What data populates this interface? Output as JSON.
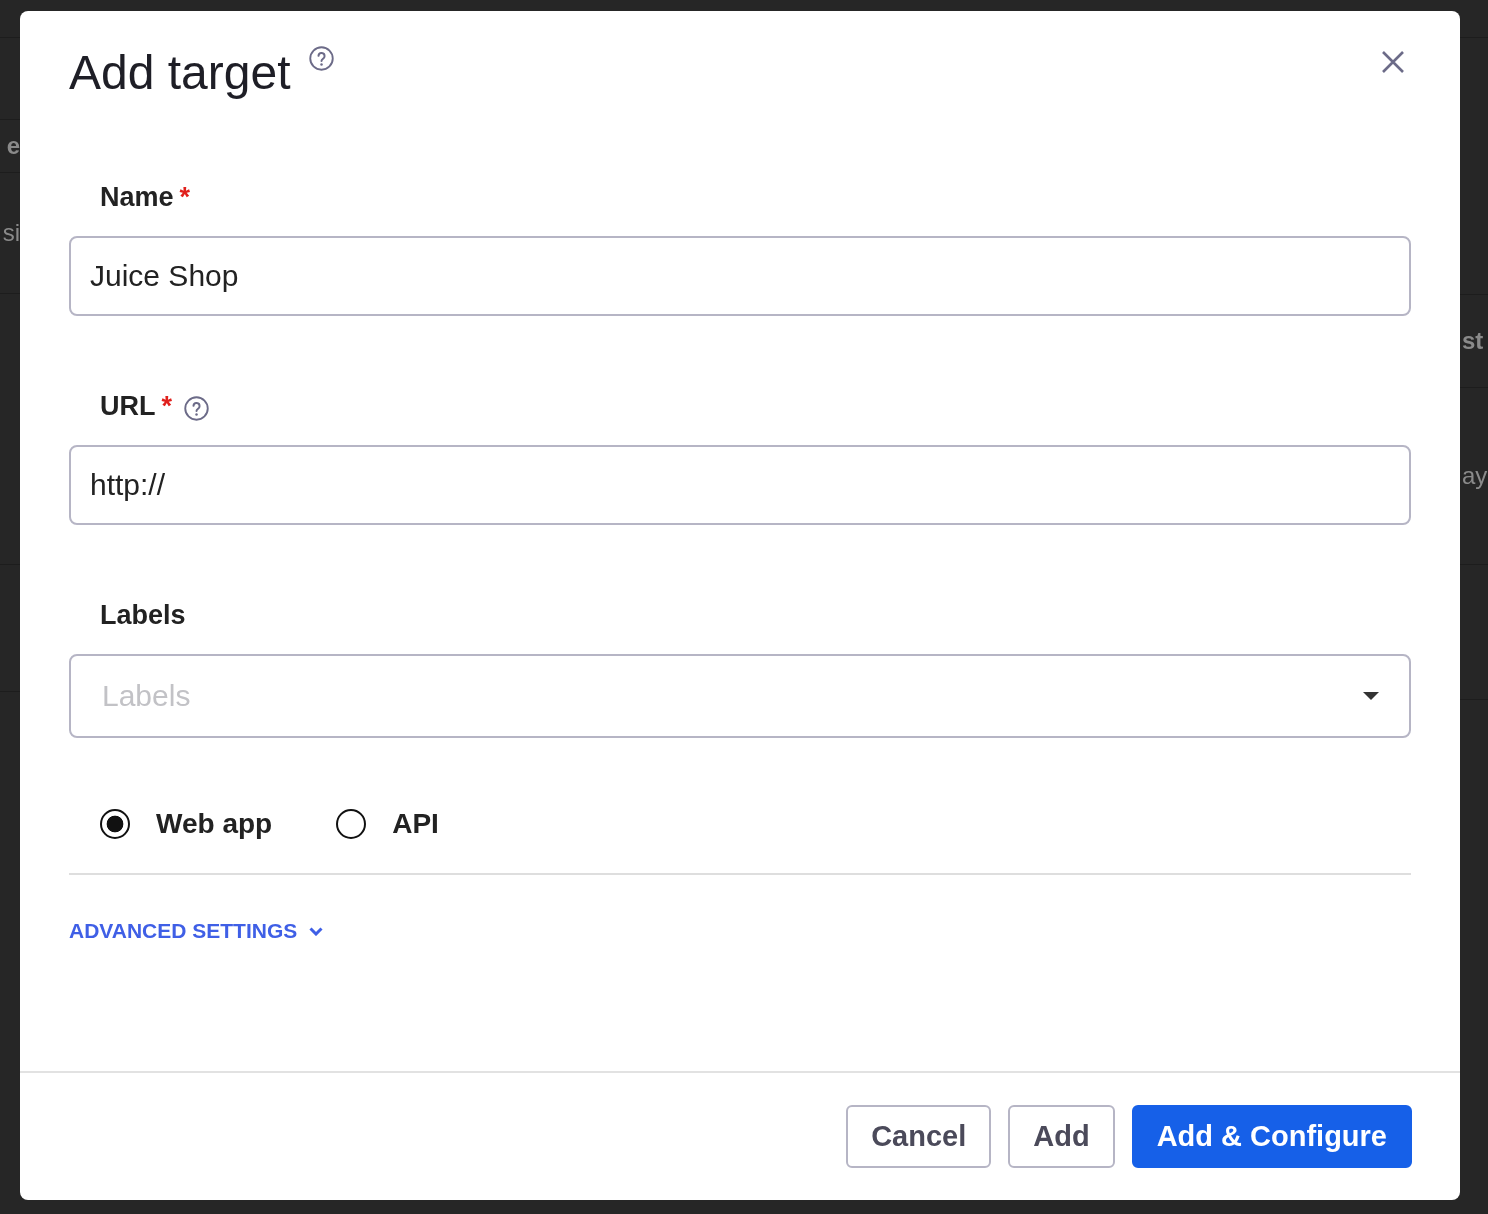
{
  "background": {
    "left_column": [
      {
        "text": "e"
      },
      {
        "text": "si"
      }
    ],
    "right_column": [
      {
        "text": "st"
      },
      {
        "text": "ay"
      }
    ]
  },
  "dialog": {
    "title": "Add target",
    "fields": [
      {
        "kind": "text",
        "label": "Name",
        "required_mark": "*",
        "help": false,
        "value": "Juice Shop"
      },
      {
        "kind": "text",
        "label": "URL",
        "required_mark": "*",
        "help": true,
        "value": "http://"
      },
      {
        "kind": "select",
        "label": "Labels",
        "help": false,
        "placeholder": "Labels"
      }
    ],
    "type_options": [
      {
        "label": "Web app",
        "selected": true
      },
      {
        "label": "API",
        "selected": false
      }
    ],
    "advanced_settings": {
      "label": "ADVANCED SETTINGS",
      "expanded": false
    },
    "buttons": [
      {
        "label": "Cancel",
        "kind": "secondary"
      },
      {
        "label": "Add",
        "kind": "secondary"
      },
      {
        "label": "Add & Configure",
        "kind": "primary"
      }
    ]
  }
}
